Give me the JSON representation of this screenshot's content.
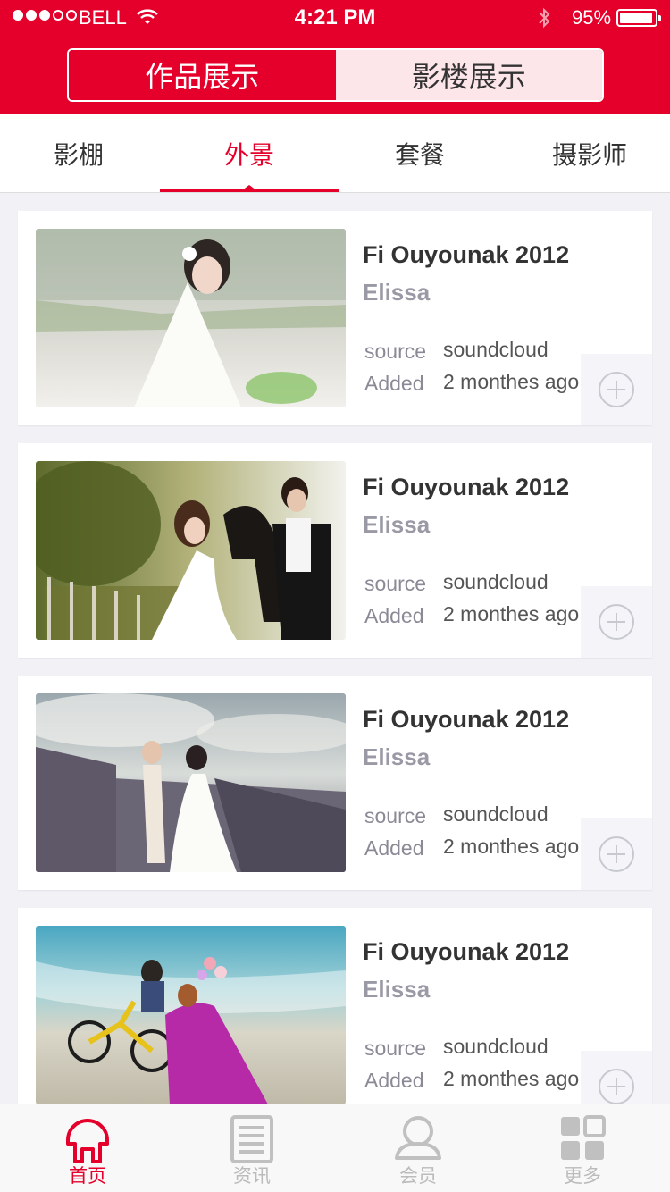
{
  "status_bar": {
    "carrier": "BELL",
    "time": "4:21 PM",
    "battery": "95%"
  },
  "segment": {
    "options": [
      "作品展示",
      "影楼展示"
    ],
    "selected": "作品展示"
  },
  "tabs": {
    "items": [
      "影棚",
      "外景",
      "套餐",
      "摄影师"
    ],
    "selected": "外景"
  },
  "cards": [
    {
      "title": "Fi Ouyounak 2012",
      "artist": "Elissa",
      "source_label": "source",
      "source_value": "soundcloud",
      "added_label": "Added",
      "added_value": "2 monthes ago"
    },
    {
      "title": "Fi Ouyounak 2012",
      "artist": "Elissa",
      "source_label": "source",
      "source_value": "soundcloud",
      "added_label": "Added",
      "added_value": "2 monthes ago"
    },
    {
      "title": "Fi Ouyounak 2012",
      "artist": "Elissa",
      "source_label": "source",
      "source_value": "soundcloud",
      "added_label": "Added",
      "added_value": "2 monthes ago"
    },
    {
      "title": "Fi Ouyounak 2012",
      "artist": "Elissa",
      "source_label": "source",
      "source_value": "soundcloud",
      "added_label": "Added",
      "added_value": "2 monthes ago"
    }
  ],
  "tab_bar": {
    "items": [
      {
        "label": "首页",
        "icon": "home-icon"
      },
      {
        "label": "资讯",
        "icon": "news-icon"
      },
      {
        "label": "会员",
        "icon": "member-icon"
      },
      {
        "label": "更多",
        "icon": "more-icon"
      }
    ],
    "selected": "首页"
  },
  "colors": {
    "accent": "#e4002b",
    "segment_inactive": "#fde6ea",
    "muted": "#9a9aa6"
  }
}
